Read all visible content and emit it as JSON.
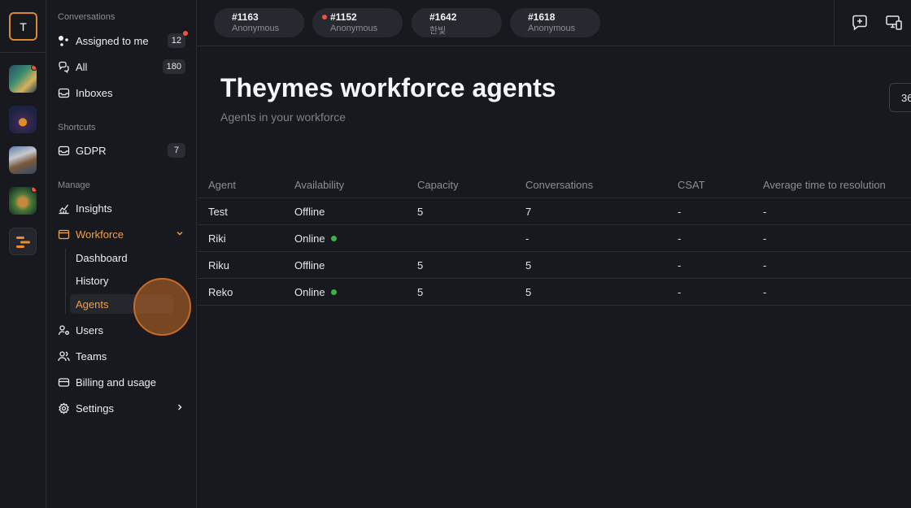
{
  "rail": {
    "avatar_letter": "T",
    "workspaces": [
      {
        "name": "workspace-1",
        "notification": true
      },
      {
        "name": "workspace-2",
        "notification": false
      },
      {
        "name": "workspace-3",
        "notification": false
      },
      {
        "name": "workspace-4",
        "notification": true
      },
      {
        "name": "workspace-5",
        "notification": false
      }
    ]
  },
  "sidebar": {
    "conversations_title": "Conversations",
    "assigned_label": "Assigned to me",
    "assigned_count": "12",
    "all_label": "All",
    "all_count": "180",
    "inboxes_label": "Inboxes",
    "shortcuts_title": "Shortcuts",
    "gdpr_label": "GDPR",
    "gdpr_count": "7",
    "manage_title": "Manage",
    "insights_label": "Insights",
    "workforce_label": "Workforce",
    "workforce_sub": [
      "Dashboard",
      "History",
      "Agents"
    ],
    "users_label": "Users",
    "teams_label": "Teams",
    "billing_label": "Billing and usage",
    "settings_label": "Settings"
  },
  "tabs": [
    {
      "id": "#1163",
      "name": "Anonymous",
      "unread": false
    },
    {
      "id": "#1152",
      "name": "Anonymous",
      "unread": true
    },
    {
      "id": "#1642",
      "name": "한빛",
      "unread": false
    },
    {
      "id": "#1618",
      "name": "Anonymous",
      "unread": false
    }
  ],
  "main": {
    "title": "Theymes workforce agents",
    "subtitle": "Agents in your workforce",
    "range_button": "36"
  },
  "table": {
    "headers": [
      "Agent",
      "Availability",
      "Capacity",
      "Conversations",
      "CSAT",
      "Average time to resolution"
    ],
    "rows": [
      {
        "agent": "Test",
        "availability": "Offline",
        "online": false,
        "capacity": "5",
        "conversations": "7",
        "csat": "-",
        "avg": "-"
      },
      {
        "agent": "Riki",
        "availability": "Online",
        "online": true,
        "capacity": "",
        "conversations": "-",
        "csat": "-",
        "avg": "-"
      },
      {
        "agent": "Riku",
        "availability": "Offline",
        "online": false,
        "capacity": "5",
        "conversations": "5",
        "csat": "-",
        "avg": "-"
      },
      {
        "agent": "Reko",
        "availability": "Online",
        "online": true,
        "capacity": "5",
        "conversations": "5",
        "csat": "-",
        "avg": "-"
      }
    ]
  },
  "colors": {
    "accent": "#f0a24a",
    "background": "#17191e",
    "online": "#3fb33f",
    "notification": "#f0533d"
  }
}
